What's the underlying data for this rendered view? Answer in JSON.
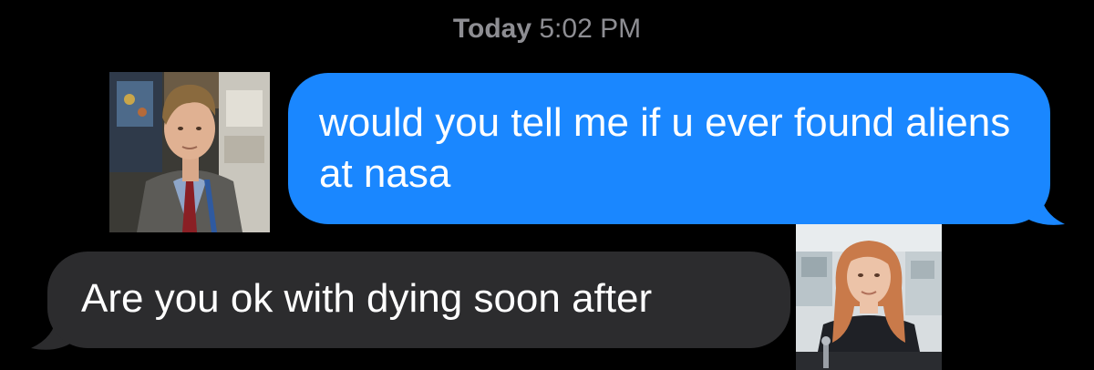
{
  "header": {
    "day": "Today",
    "time": "5:02 PM"
  },
  "messages": [
    {
      "direction": "sent",
      "text": "would you tell me if u ever found aliens at nasa",
      "bubble_color": "#1a87ff"
    },
    {
      "direction": "received",
      "text": "Are you ok with dying soon after",
      "bubble_color": "#2c2c2e"
    }
  ],
  "colors": {
    "background": "#000000",
    "timestamp": "#8e8e93",
    "text": "#ffffff"
  }
}
